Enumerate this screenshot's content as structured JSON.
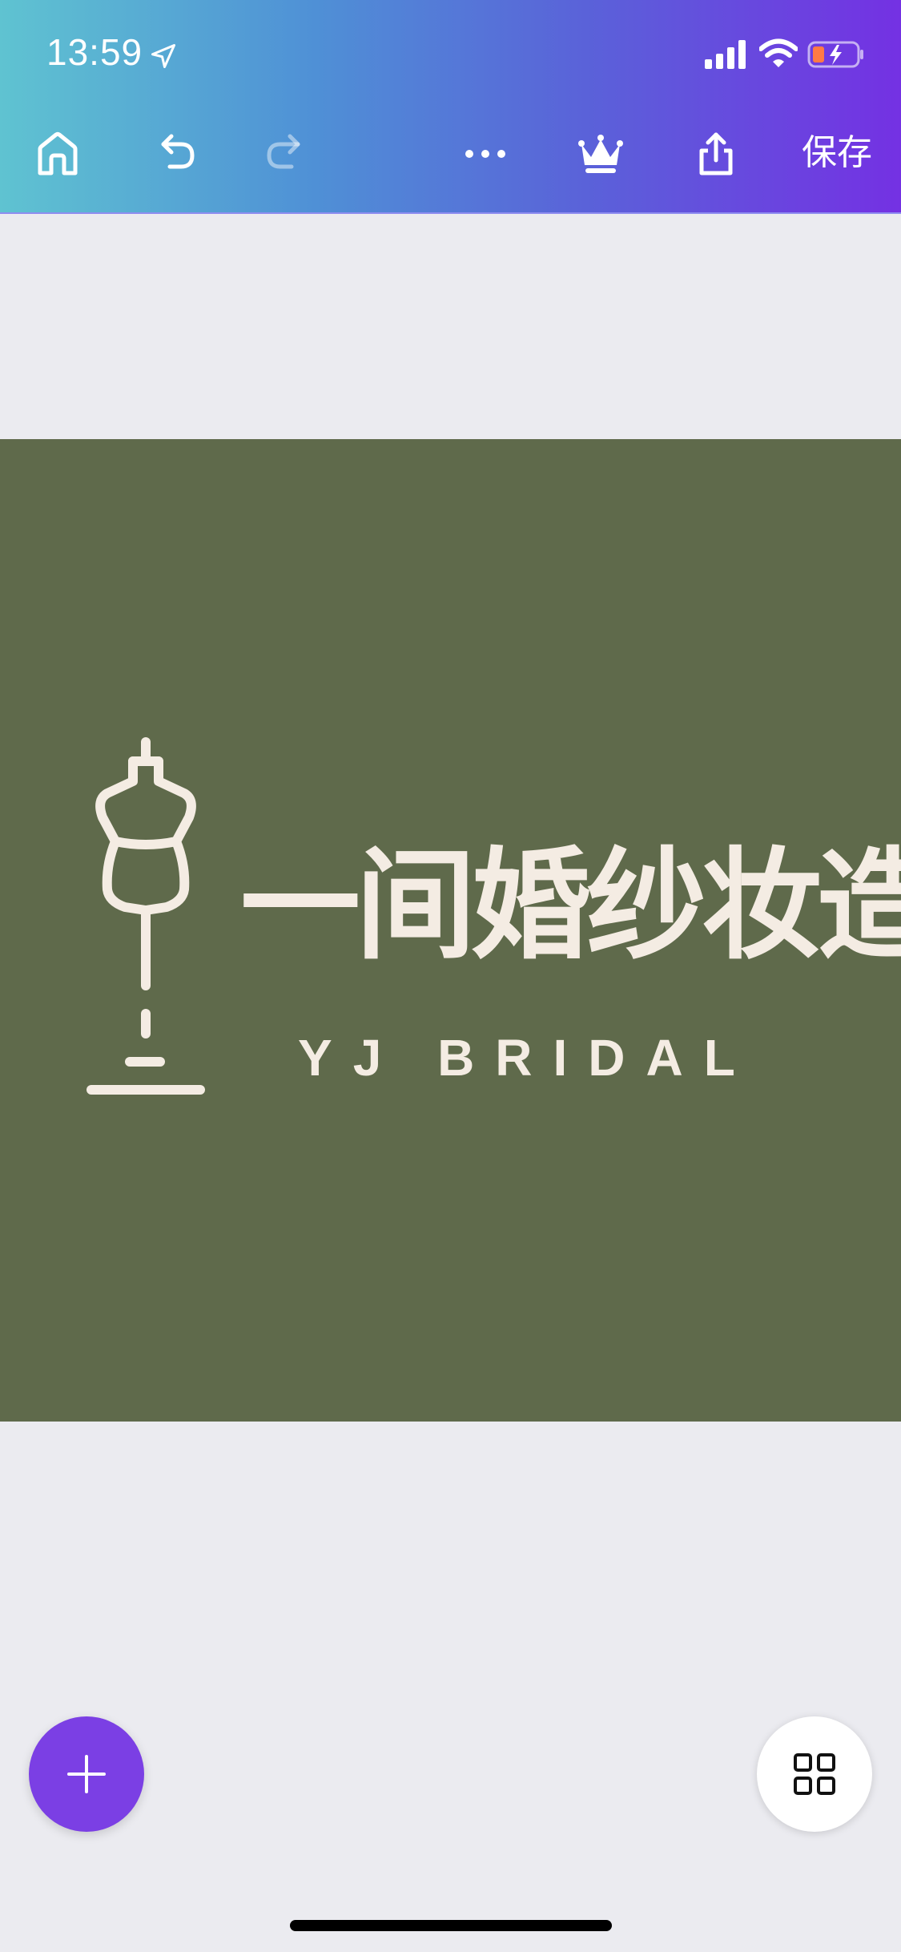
{
  "status_bar": {
    "time": "13:59",
    "icons": [
      "location-arrow-icon",
      "cellular-signal-icon",
      "wifi-icon",
      "battery-charging-icon"
    ]
  },
  "toolbar": {
    "icons": [
      "home-icon",
      "undo-icon",
      "redo-icon",
      "more-icon",
      "crown-icon",
      "share-icon"
    ],
    "redo_enabled": false,
    "save_label": "保存"
  },
  "canvas": {
    "background_color": "#5f6a4b",
    "text_color": "#f4ece3",
    "logo_icon": "dress-form-icon",
    "title_cn": "一间婚纱妆造",
    "title_en": "YJ BRIDAL"
  },
  "fab": {
    "add_icon": "plus-icon",
    "add_color": "#7b3fe4",
    "pages_icon": "grid-icon"
  },
  "colors": {
    "gradient_start": "#5fc3d1",
    "gradient_end": "#7431e3",
    "app_background": "#ebebf0"
  }
}
